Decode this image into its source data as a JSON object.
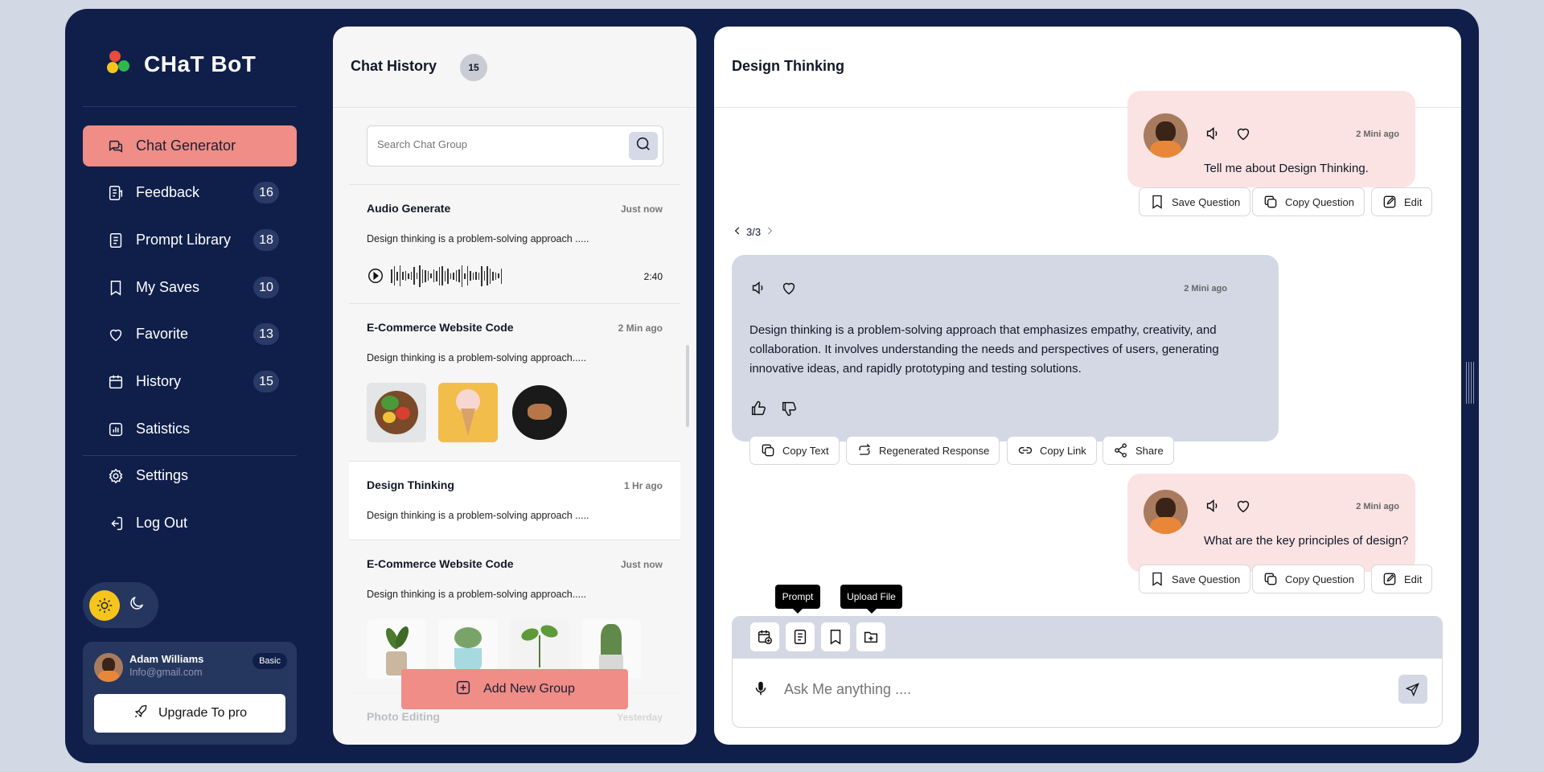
{
  "app": {
    "logo_text": "CHaT BoT"
  },
  "sidebar": {
    "items": [
      {
        "label": "Chat Generator",
        "badge": "",
        "icon": "chat-bubbles-icon",
        "active": true
      },
      {
        "label": "Feedback",
        "badge": "16",
        "icon": "feedback-icon"
      },
      {
        "label": "Prompt Library",
        "badge": "18",
        "icon": "document-icon"
      },
      {
        "label": "My Saves",
        "badge": "10",
        "icon": "bookmark-icon"
      },
      {
        "label": "Favorite",
        "badge": "13",
        "icon": "heart-icon"
      },
      {
        "label": "History",
        "badge": "15",
        "icon": "calendar-icon"
      },
      {
        "label": "Satistics",
        "badge": "",
        "icon": "stats-icon"
      },
      {
        "label": "Settings",
        "badge": "",
        "icon": "gear-icon"
      },
      {
        "label": "Log Out",
        "badge": "",
        "icon": "logout-icon"
      }
    ],
    "theme": {
      "light_icon": "sun-icon",
      "dark_icon": "moon-icon"
    },
    "user": {
      "name": "Adam Williams",
      "email": "Info@gmail.com",
      "plan": "Basic"
    },
    "upgrade_label": "Upgrade To pro"
  },
  "history": {
    "title": "Chat History",
    "count": "15",
    "search_placeholder": "Search Chat Group",
    "items": [
      {
        "title": "Audio Generate",
        "time": "Just now",
        "desc": "Design thinking is a problem-solving approach .....",
        "duration": "2:40"
      },
      {
        "title": "E-Commerce Website Code",
        "time": "2 Min ago",
        "desc": "Design thinking is a problem-solving approach....."
      },
      {
        "title": "Design Thinking",
        "time": "1 Hr ago",
        "desc": "Design thinking is a problem-solving approach ....."
      },
      {
        "title": "E-Commerce Website Code",
        "time": "Just now",
        "desc": "Design thinking is a problem-solving approach....."
      },
      {
        "title": "Photo Editing",
        "time": "Yesterday",
        "desc": ""
      }
    ],
    "add_group_label": "Add New Group"
  },
  "chat": {
    "title": "Design Thinking",
    "q1": {
      "time": "2 Mini ago",
      "text": "Tell me about Design Thinking."
    },
    "pager": "3/3",
    "answer": {
      "time": "2 Mini ago",
      "text": "Design thinking is a problem-solving approach that emphasizes empathy, creativity, and collaboration. It involves understanding the needs and perspectives of users, generating innovative ideas, and rapidly prototyping and testing solutions."
    },
    "q2": {
      "time": "2 Mini ago",
      "text": "What are the key principles of design?"
    },
    "question_actions": {
      "save": "Save Question",
      "copy": "Copy Question",
      "edit": "Edit"
    },
    "answer_actions": {
      "copy_text": "Copy Text",
      "regenerate": "Regenerated Response",
      "copy_link": "Copy Link",
      "share": "Share"
    },
    "tooltips": {
      "prompt": "Prompt",
      "upload": "Upload File"
    },
    "input_placeholder": "Ask Me anything ...."
  },
  "colors": {
    "frame": "#0f1f4a",
    "accent": "#ef8d86",
    "question_bg": "#fbe3e3",
    "answer_bg": "#d3d8e4"
  }
}
